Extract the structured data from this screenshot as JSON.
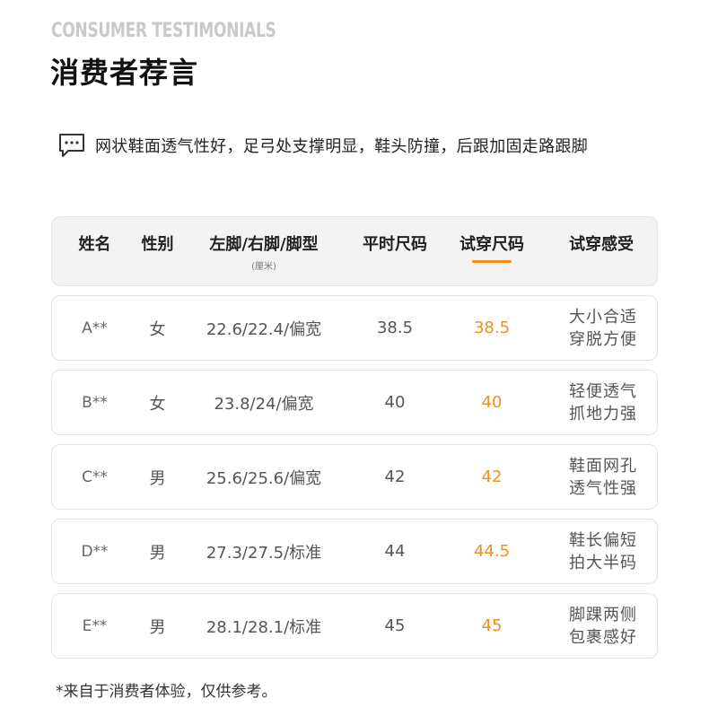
{
  "header": {
    "eyebrow": "CONSUMER TESTIMONIALS",
    "title": "消费者荐言"
  },
  "quote": {
    "icon": "chat-bubble-icon",
    "text": "网状鞋面透气性好，足弓处支撑明显，鞋头防撞，后跟加固走路跟脚"
  },
  "table": {
    "columns": {
      "name": "姓名",
      "gender": "性别",
      "foot": "左脚/右脚/脚型",
      "foot_unit": "(厘米)",
      "usual_size": "平时尺码",
      "trial_size": "试穿尺码",
      "feeling": "试穿感受"
    },
    "accent_color": "#ef8f1d",
    "rows": [
      {
        "name": "A**",
        "gender": "女",
        "foot": "22.6/22.4/偏宽",
        "usual": "38.5",
        "trial": "38.5",
        "feel1": "大小合适",
        "feel2": "穿脱方便"
      },
      {
        "name": "B**",
        "gender": "女",
        "foot": "23.8/24/偏宽",
        "usual": "40",
        "trial": "40",
        "feel1": "轻便透气",
        "feel2": "抓地力强"
      },
      {
        "name": "C**",
        "gender": "男",
        "foot": "25.6/25.6/偏宽",
        "usual": "42",
        "trial": "42",
        "feel1": "鞋面网孔",
        "feel2": "透气性强"
      },
      {
        "name": "D**",
        "gender": "男",
        "foot": "27.3/27.5/标准",
        "usual": "44",
        "trial": "44.5",
        "feel1": "鞋长偏短",
        "feel2": "拍大半码"
      },
      {
        "name": "E**",
        "gender": "男",
        "foot": "28.1/28.1/标准",
        "usual": "45",
        "trial": "45",
        "feel1": "脚踝两侧",
        "feel2": "包裹感好"
      }
    ]
  },
  "footnote": "*来自于消费者体验，仅供参考。"
}
